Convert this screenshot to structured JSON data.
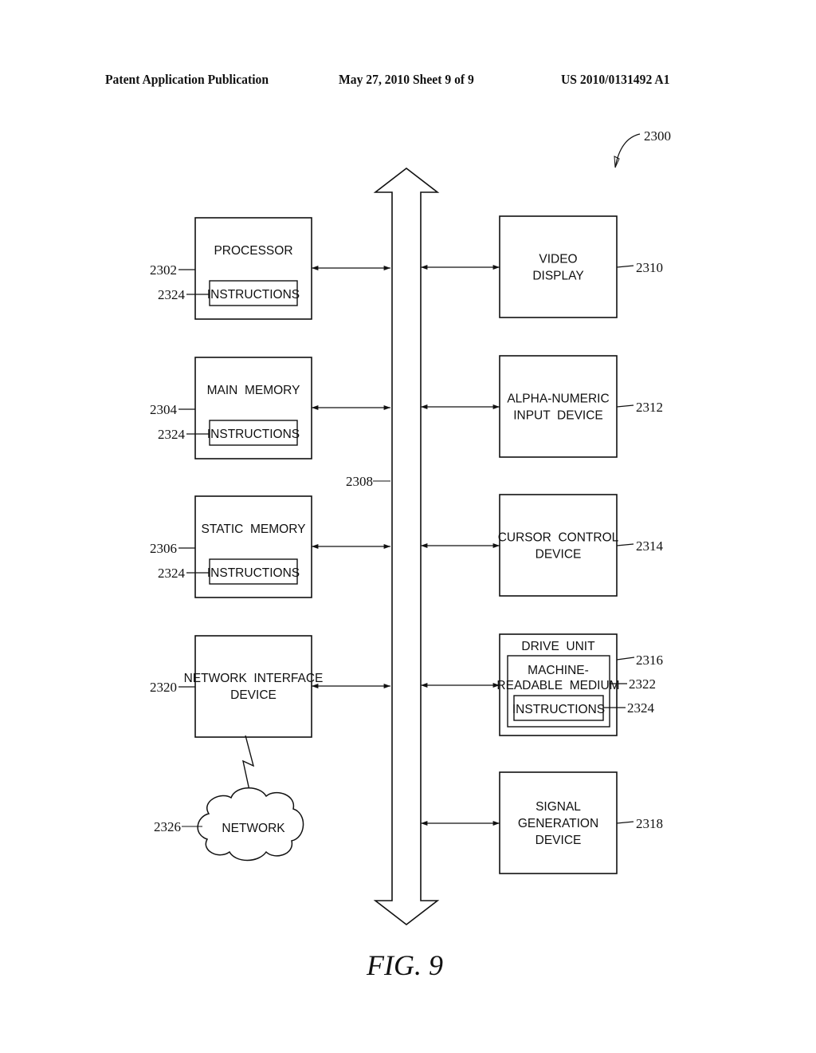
{
  "header": {
    "left": "Patent Application Publication",
    "center": "May 27, 2010  Sheet 9 of 9",
    "right": "US 2010/0131492 A1"
  },
  "figure": {
    "ref": "2300",
    "caption": "FIG. 9",
    "bus_ref": "2308",
    "left_blocks": [
      {
        "id": "processor",
        "ref": "2302",
        "lines": [
          "PROCESSOR"
        ],
        "inner": {
          "label": "INSTRUCTIONS",
          "ref": "2324"
        }
      },
      {
        "id": "main-memory",
        "ref": "2304",
        "lines": [
          "MAIN  MEMORY"
        ],
        "inner": {
          "label": "INSTRUCTIONS",
          "ref": "2324"
        }
      },
      {
        "id": "static-memory",
        "ref": "2306",
        "lines": [
          "STATIC  MEMORY"
        ],
        "inner": {
          "label": "INSTRUCTIONS",
          "ref": "2324"
        }
      },
      {
        "id": "network-interface-device",
        "ref": "2320",
        "lines": [
          "NETWORK  INTERFACE",
          "DEVICE"
        ]
      }
    ],
    "network": {
      "label": "NETWORK",
      "ref": "2326"
    },
    "right_blocks": [
      {
        "id": "video-display",
        "ref": "2310",
        "lines": [
          "VIDEO",
          "DISPLAY"
        ]
      },
      {
        "id": "alpha-numeric-input-device",
        "ref": "2312",
        "lines": [
          "ALPHA-NUMERIC",
          "INPUT  DEVICE"
        ]
      },
      {
        "id": "cursor-control-device",
        "ref": "2314",
        "lines": [
          "CURSOR  CONTROL",
          "DEVICE"
        ]
      },
      {
        "id": "drive-unit",
        "ref": "2316",
        "lines": [
          "DRIVE  UNIT"
        ],
        "medium": {
          "lines": [
            "MACHINE-",
            "READABLE  MEDIUM"
          ],
          "ref": "2322"
        },
        "inner": {
          "label": "INSTRUCTIONS",
          "ref": "2324"
        }
      },
      {
        "id": "signal-generation-device",
        "ref": "2318",
        "lines": [
          "SIGNAL",
          "GENERATION",
          "DEVICE"
        ]
      }
    ]
  }
}
